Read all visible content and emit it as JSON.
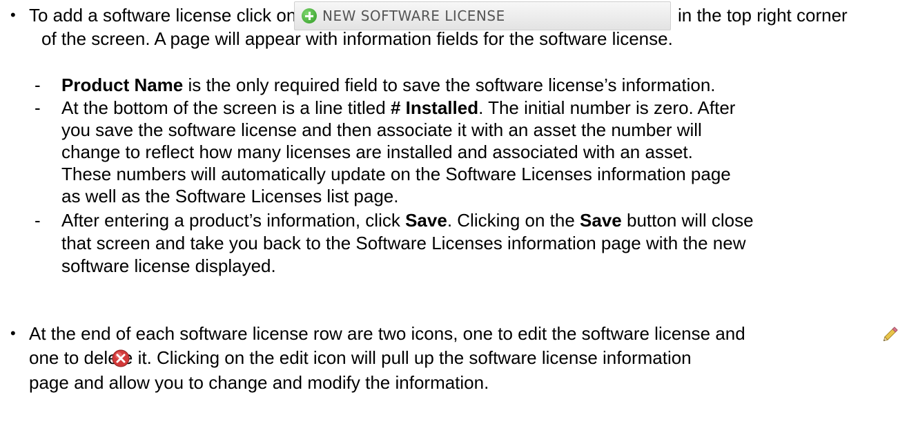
{
  "bullets": [
    {
      "lines": [
        {
          "before": "To add a software license click on the",
          "after": "in the top right corner"
        },
        {
          "text": "of the screen. A page will appear with information fields for the software license."
        }
      ]
    },
    {
      "lines": [
        {
          "text": "At the end of each software license row are two icons, one to edit the software license and"
        },
        {
          "text": "one to delete it. Clicking on the edit icon will pull up the software license information"
        },
        {
          "text": "page and allow you to change and modify the information."
        }
      ]
    }
  ],
  "button_image": {
    "label": "NEW SOFTWARE LICENSE",
    "icon": "plus-circle-icon",
    "icon_color": "#3aa52b"
  },
  "sub_items": [
    {
      "bold": "Product Name",
      "rest": " is the only required field to save the software license’s information."
    },
    {
      "line1_before": "At the bottom of the screen is a line titled ",
      "line1_bold": "# Installed",
      "line1_after": ". The initial number is zero. After",
      "lines": [
        "you save the software license and then associate it with an asset the number will",
        "change to reflect how many licenses are installed and associated with an asset.",
        "These numbers will automatically update on the Software Licenses information page",
        "as well as the Software Licenses list page."
      ]
    },
    {
      "line1_before": "After entering a product’s information, click ",
      "line1_bold1": "Save",
      "line1_mid": ". Clicking on the ",
      "line1_bold2": "Save",
      "line1_after": " button will close",
      "lines": [
        "that screen and take you back to the Software Licenses information page with the new",
        "software license displayed."
      ]
    }
  ],
  "icons": {
    "edit": "pencil-edit-icon",
    "delete": "red-x-delete-icon"
  },
  "symbols": {
    "bullet": "•",
    "dash": "-"
  }
}
